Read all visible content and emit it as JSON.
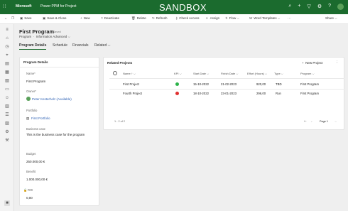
{
  "header": {
    "brand": "Microsoft",
    "app_name": "Power PPM for Project",
    "environment": "SANDBOX",
    "icons": [
      "search-icon",
      "plus-icon",
      "filter-icon",
      "settings-icon",
      "help-icon",
      "user-avatar"
    ]
  },
  "commands": {
    "back": "←",
    "open_window": "❐",
    "save": "Save",
    "save_close": "Save & Close",
    "new": "New",
    "deactivate": "Deactivate",
    "delete": "Delete",
    "refresh": "Refresh",
    "check_access": "Check Access",
    "assign": "Assign",
    "flow": "Flow",
    "word_templates": "Word Templates",
    "more": "⋯",
    "share": "Share"
  },
  "record": {
    "title": "First Program",
    "saved_status": "- Saved",
    "entity": "Program",
    "form_selector": "Information Advanced"
  },
  "tabs": [
    "Program Details",
    "Schedule",
    "Financials",
    "Related"
  ],
  "details": {
    "section_title": "Program Details",
    "name_label": "Name*",
    "name_value": "First Program",
    "owner_label": "Owner*",
    "owner_value": "Peter Kesterholz (Available)",
    "portfolio_label": "Portfolio",
    "portfolio_value": "First Portfolio",
    "business_case_label": "Business case",
    "business_case_value": "This is the business case for the program",
    "budget_label": "Budget",
    "budget_value": "250.000,00 €",
    "benefit_label": "Benefit",
    "benefit_value": "1.000.000,00 €",
    "roi_label": "ROI",
    "roi_value": "0,00"
  },
  "related": {
    "title": "Related Projects",
    "new_button": "New Project",
    "columns": [
      "Name",
      "KPI",
      "Start Date",
      "Finish Date",
      "Effort (Hours)",
      "Type",
      "Program"
    ],
    "rows": [
      {
        "name": "First Project",
        "kpi_color": "#2db34a",
        "start": "15-10-2022",
        "finish": "21-02-2023",
        "effort": "920,00",
        "type": "TBD",
        "program": "First Program"
      },
      {
        "name": "Fourth Project",
        "kpi_color": "#e03030",
        "start": "18-10-2022",
        "finish": "23-01-2023",
        "effort": "296,00",
        "type": "Run",
        "program": "First Program"
      }
    ],
    "count_text": "1 - 2 of 2",
    "page_text": "Page 1"
  }
}
